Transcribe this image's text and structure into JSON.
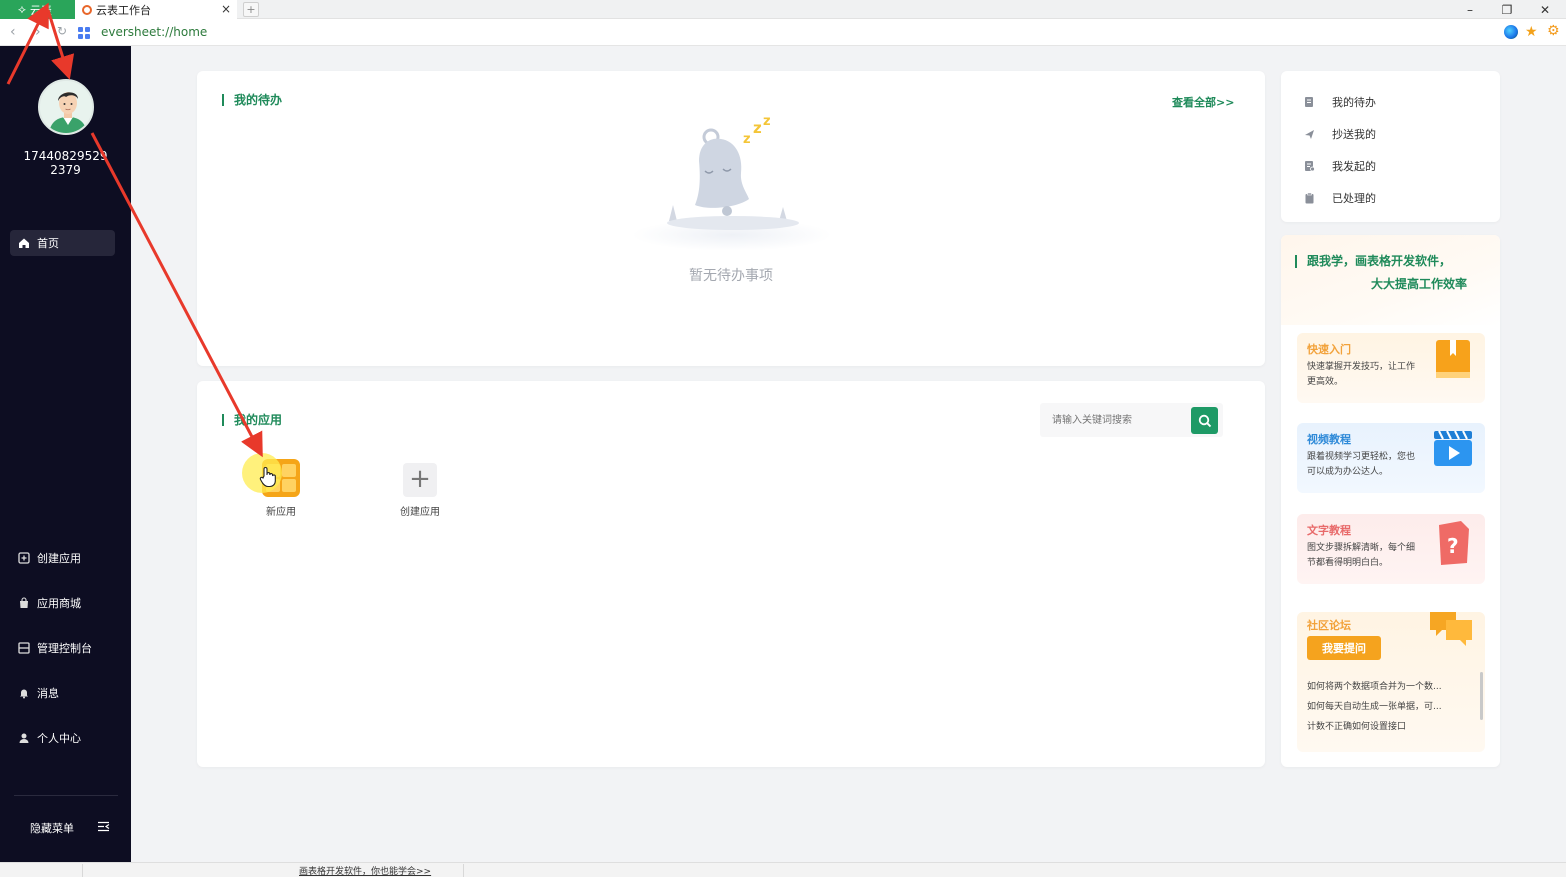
{
  "browser": {
    "app_badge_label": "云表",
    "active_tab_title": "云表工作台",
    "tab_close": "×",
    "new_tab": "+",
    "url": "eversheet://home",
    "window_controls": {
      "minimize": "–",
      "restore": "❐",
      "close": "✕"
    }
  },
  "sidebar": {
    "username": "17440829529\n2379",
    "nav": [
      {
        "label": "首页",
        "icon": "home-icon",
        "active": true
      },
      {
        "label": "创建应用",
        "icon": "create-app-icon"
      },
      {
        "label": "应用商城",
        "icon": "store-icon"
      },
      {
        "label": "管理控制台",
        "icon": "console-icon"
      },
      {
        "label": "消息",
        "icon": "bell-icon"
      },
      {
        "label": "个人中心",
        "icon": "user-icon"
      }
    ],
    "hide_menu": "隐藏菜单"
  },
  "todo": {
    "title": "我的待办",
    "view_all": "查看全部>>",
    "empty_text": "暂无待办事项"
  },
  "apps": {
    "title": "我的应用",
    "search_placeholder": "请输入关键词搜索",
    "items": [
      {
        "label": "新应用"
      },
      {
        "label": "创建应用"
      }
    ]
  },
  "quick_links": [
    {
      "label": "我的待办",
      "icon": "todo-doc-icon"
    },
    {
      "label": "抄送我的",
      "icon": "send-icon"
    },
    {
      "label": "我发起的",
      "icon": "initiated-doc-icon"
    },
    {
      "label": "已处理的",
      "icon": "clipboard-icon"
    }
  ],
  "learn": {
    "title_line1": "跟我学，画表格开发软件，",
    "title_line2": "大大提高工作效率",
    "items": [
      {
        "title": "快速入门",
        "desc": "快速掌握开发技巧，让工作更高效。",
        "color": "#f2a23a"
      },
      {
        "title": "视频教程",
        "desc": "跟着视频学习更轻松，您也可以成为办公达人。",
        "color": "#2f8ad8"
      },
      {
        "title": "文字教程",
        "desc": "图文步骤拆解清晰，每个细节都看得明明白白。",
        "color": "#e86a6a"
      }
    ],
    "forum": {
      "title": "社区论坛",
      "ask_button": "我要提问",
      "questions": [
        "如何将两个数据项合并为一个数...",
        "如何每天自动生成一张单据，可...",
        "计数不正确如何设置接口"
      ]
    }
  },
  "statusbar": {
    "link": "画表格开发软件，你也能学会>>"
  },
  "colors": {
    "brand_green": "#1f8a5a",
    "sidebar_bg": "#0d0d22",
    "annotation_red": "#e8392b"
  }
}
